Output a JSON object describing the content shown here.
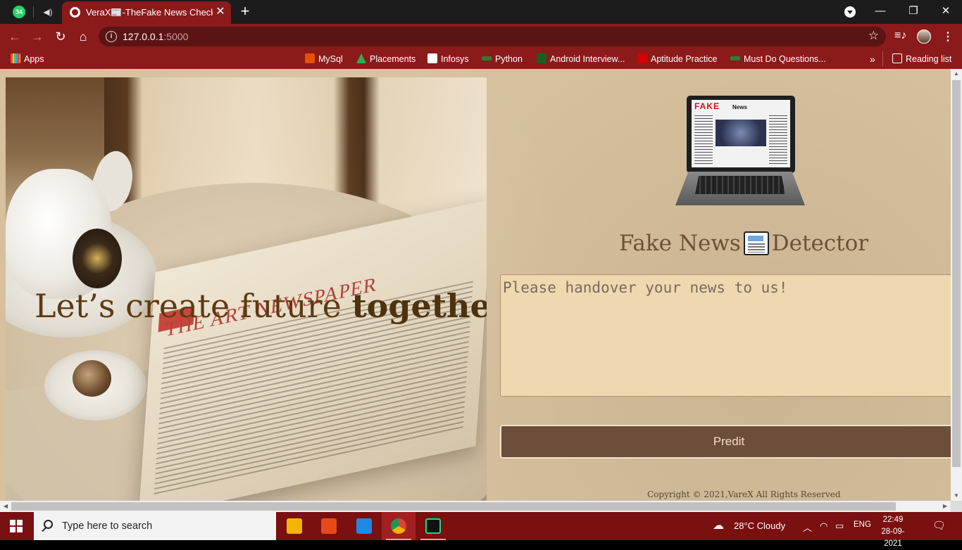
{
  "browser": {
    "tab_badge": "34",
    "tab_title": "VeraX📰-TheFake News Checker",
    "url_host": "127.0.0.1",
    "url_port": ":5000",
    "bookmarks": [
      {
        "label": "Apps",
        "color": "#ffb300"
      },
      {
        "label": "MySql",
        "color": "#e65100"
      },
      {
        "label": "Placements",
        "color": "#34a853"
      },
      {
        "label": "Infosys",
        "color": "#ffffff"
      },
      {
        "label": "Python",
        "color": "#2e7d32"
      },
      {
        "label": "Android Interview...",
        "color": "#1b5e20"
      },
      {
        "label": "Aptitude Practice",
        "color": "#d50000"
      },
      {
        "label": "Must Do Questions...",
        "color": "#2e7d32"
      }
    ],
    "more_bookmarks": "»",
    "reading_list": "Reading list"
  },
  "page": {
    "hero_text_normal": "Let’s create future ",
    "hero_text_bold": "together",
    "newspaper_masthead": "THE ART NEWSPAPER",
    "laptop_fake": "FAKE",
    "laptop_news": "News",
    "title_left": "Fake News",
    "title_right": "Detector",
    "input_placeholder": "Please handover your news to us!",
    "predict_label": "Predit",
    "copyright": "Copyright © 2021,VareX All Rights Reserved"
  },
  "taskbar": {
    "search_placeholder": "Type here to search",
    "weather": "28°C  Cloudy",
    "language": "ENG",
    "time": "22:49",
    "date": "28-09-2021"
  },
  "colors": {
    "browser_chrome": "#8b1a1a",
    "tab_strip": "#1c1c1c",
    "taskbar": "#7a1010",
    "button": "#6b4f3a",
    "input_bg": "#efd8b0"
  }
}
